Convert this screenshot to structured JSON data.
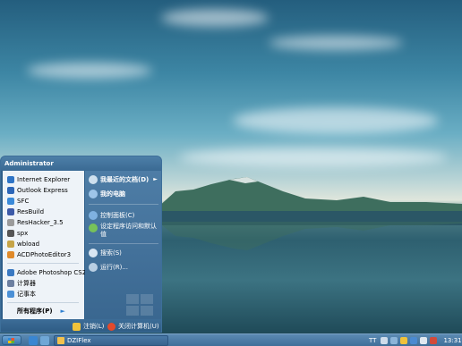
{
  "start_menu": {
    "user_name": "Administrator",
    "pinned": [
      {
        "label": "Internet Explorer",
        "icon": "ie-icon",
        "color": "#2e74c6"
      },
      {
        "label": "Outlook Express",
        "icon": "outlook-icon",
        "color": "#2c66b8"
      },
      {
        "label": "SFC",
        "icon": "sfc-icon",
        "color": "#3a8ad9"
      },
      {
        "label": "ResBuild",
        "icon": "resbuild-icon",
        "color": "#3c5aa8"
      },
      {
        "label": "ResHacker_3.5",
        "icon": "reshacker-icon",
        "color": "#9b9b9b"
      },
      {
        "label": "spx",
        "icon": "spx-icon",
        "color": "#555555"
      },
      {
        "label": "wbload",
        "icon": "wbload-icon",
        "color": "#c6a447"
      },
      {
        "label": "ACDPhotoEditor3",
        "icon": "acd-icon",
        "color": "#e08a2a"
      }
    ],
    "recent": [
      {
        "label": "Adobe Photoshop CS2",
        "icon": "photoshop-icon",
        "color": "#3a79c2"
      },
      {
        "label": "计算器",
        "icon": "calculator-icon",
        "color": "#6c7fa0"
      },
      {
        "label": "记事本",
        "icon": "notepad-icon",
        "color": "#4b90d6"
      }
    ],
    "all_programs": "所有程序(P)",
    "right": [
      {
        "label": "我最近的文档(D)",
        "icon": "recent-docs-icon",
        "color": "#cfe0ee",
        "bold": true,
        "arrow": true
      },
      {
        "label": "我的电脑",
        "icon": "my-computer-icon",
        "color": "#9ec5e8",
        "bold": true
      },
      {
        "label": "控制面板(C)",
        "icon": "control-panel-icon",
        "color": "#7fb1e0"
      },
      {
        "label": "设定程序访问和默认值",
        "icon": "program-access-icon",
        "color": "#77c25a"
      },
      {
        "label": "搜索(S)",
        "icon": "search-icon",
        "color": "#d9e6f2"
      },
      {
        "label": "运行(R)...",
        "icon": "run-icon",
        "color": "#b9cfe3"
      }
    ],
    "footer": {
      "logoff_label": "注销(L)",
      "shutdown_label": "关闭计算机(U)"
    }
  },
  "taskbar": {
    "task_label": "DZIFlex",
    "tray_text": "TT",
    "clock": "13:31"
  },
  "colors": {
    "menu_blue": "#2f5f8a",
    "menu_left_bg": "#eef3f8",
    "taskbar": "#3f6f99"
  }
}
